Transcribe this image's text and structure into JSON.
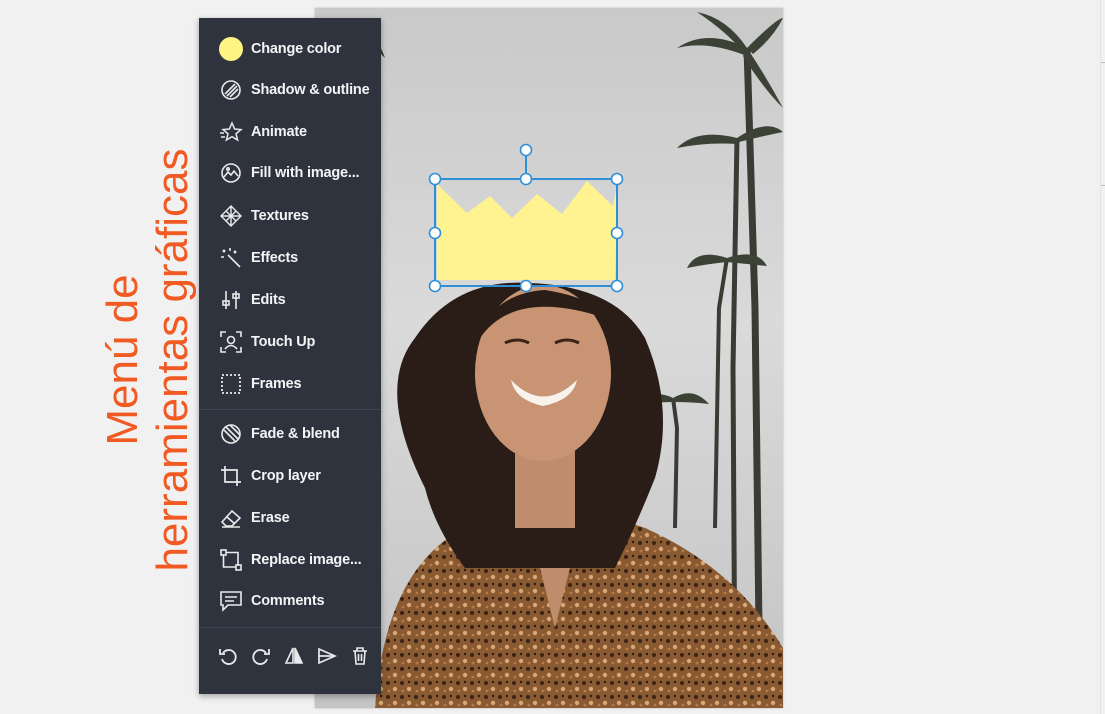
{
  "title": {
    "line1": "Menú de",
    "line2": "herramientas gráficas",
    "color": "#f15a22"
  },
  "menu": {
    "background": "#2e333d",
    "swatch_color": "#fef385",
    "items": [
      {
        "label": "Change color",
        "icon": "color-swatch-icon"
      },
      {
        "label": "Shadow & outline",
        "icon": "shadow-outline-icon"
      },
      {
        "label": "Animate",
        "icon": "animate-star-icon"
      },
      {
        "label": "Fill with image...",
        "icon": "fill-image-icon"
      },
      {
        "label": "Textures",
        "icon": "textures-icon"
      },
      {
        "label": "Effects",
        "icon": "magic-wand-icon"
      },
      {
        "label": "Edits",
        "icon": "sliders-icon"
      },
      {
        "label": "Touch Up",
        "icon": "face-scan-icon"
      },
      {
        "label": "Frames",
        "icon": "frame-icon"
      },
      {
        "label": "Fade & blend",
        "icon": "fade-blend-icon"
      },
      {
        "label": "Crop layer",
        "icon": "crop-icon"
      },
      {
        "label": "Erase",
        "icon": "eraser-icon"
      },
      {
        "label": "Replace image...",
        "icon": "replace-image-icon"
      },
      {
        "label": "Comments",
        "icon": "comment-icon"
      }
    ],
    "actions": [
      {
        "name": "undo",
        "icon": "undo-icon"
      },
      {
        "name": "redo",
        "icon": "redo-icon"
      },
      {
        "name": "flip",
        "icon": "flip-icon"
      },
      {
        "name": "send",
        "icon": "send-icon"
      },
      {
        "name": "delete",
        "icon": "trash-icon"
      }
    ]
  },
  "canvas": {
    "selected_layer": "crown-shape",
    "crown_color": "#fef390",
    "selection_color": "#2f8fd6"
  }
}
